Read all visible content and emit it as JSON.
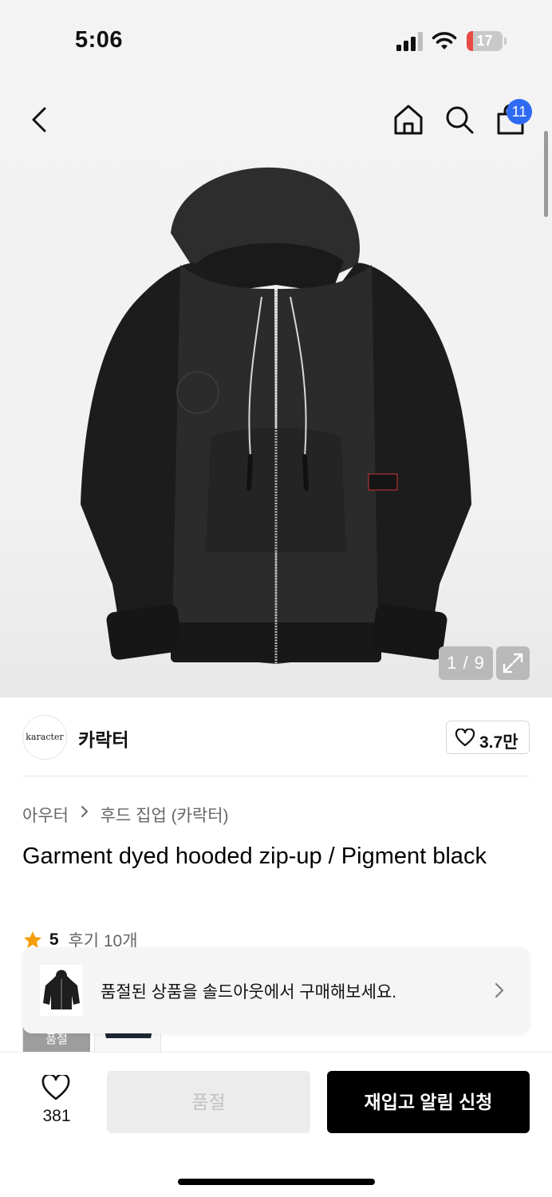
{
  "status_bar": {
    "time": "5:06",
    "battery": "17",
    "battery_level": 0.17
  },
  "header": {
    "cart_count": "11"
  },
  "gallery": {
    "counter": "1 / 9"
  },
  "brand": {
    "logo_text": "karacter",
    "name": "카락터",
    "likes": "3.7만"
  },
  "breadcrumb": {
    "category": "아우터",
    "subcategory": "후드 집업 (카락터)"
  },
  "product": {
    "title": "Garment dyed hooded zip-up / Pigment black",
    "rating": "5",
    "reviews": "후기 10개"
  },
  "thumbnails": {
    "soldout_label": "품절"
  },
  "soldout_banner": {
    "text": "품절된 상품을 솔드아웃에서 구매해보세요."
  },
  "bottom_bar": {
    "wish_count": "381",
    "soldout_label": "품절",
    "restock_label": "재입고 알림 신청"
  },
  "colors": {
    "accent_badge": "#2f6bf2",
    "star": "#f59e0b",
    "battery": "#e84a45"
  },
  "icons": [
    "back-icon",
    "home-icon",
    "search-icon",
    "shopping-bag-icon",
    "expand-icon",
    "heart-icon",
    "star-icon",
    "chevron-right-icon"
  ]
}
